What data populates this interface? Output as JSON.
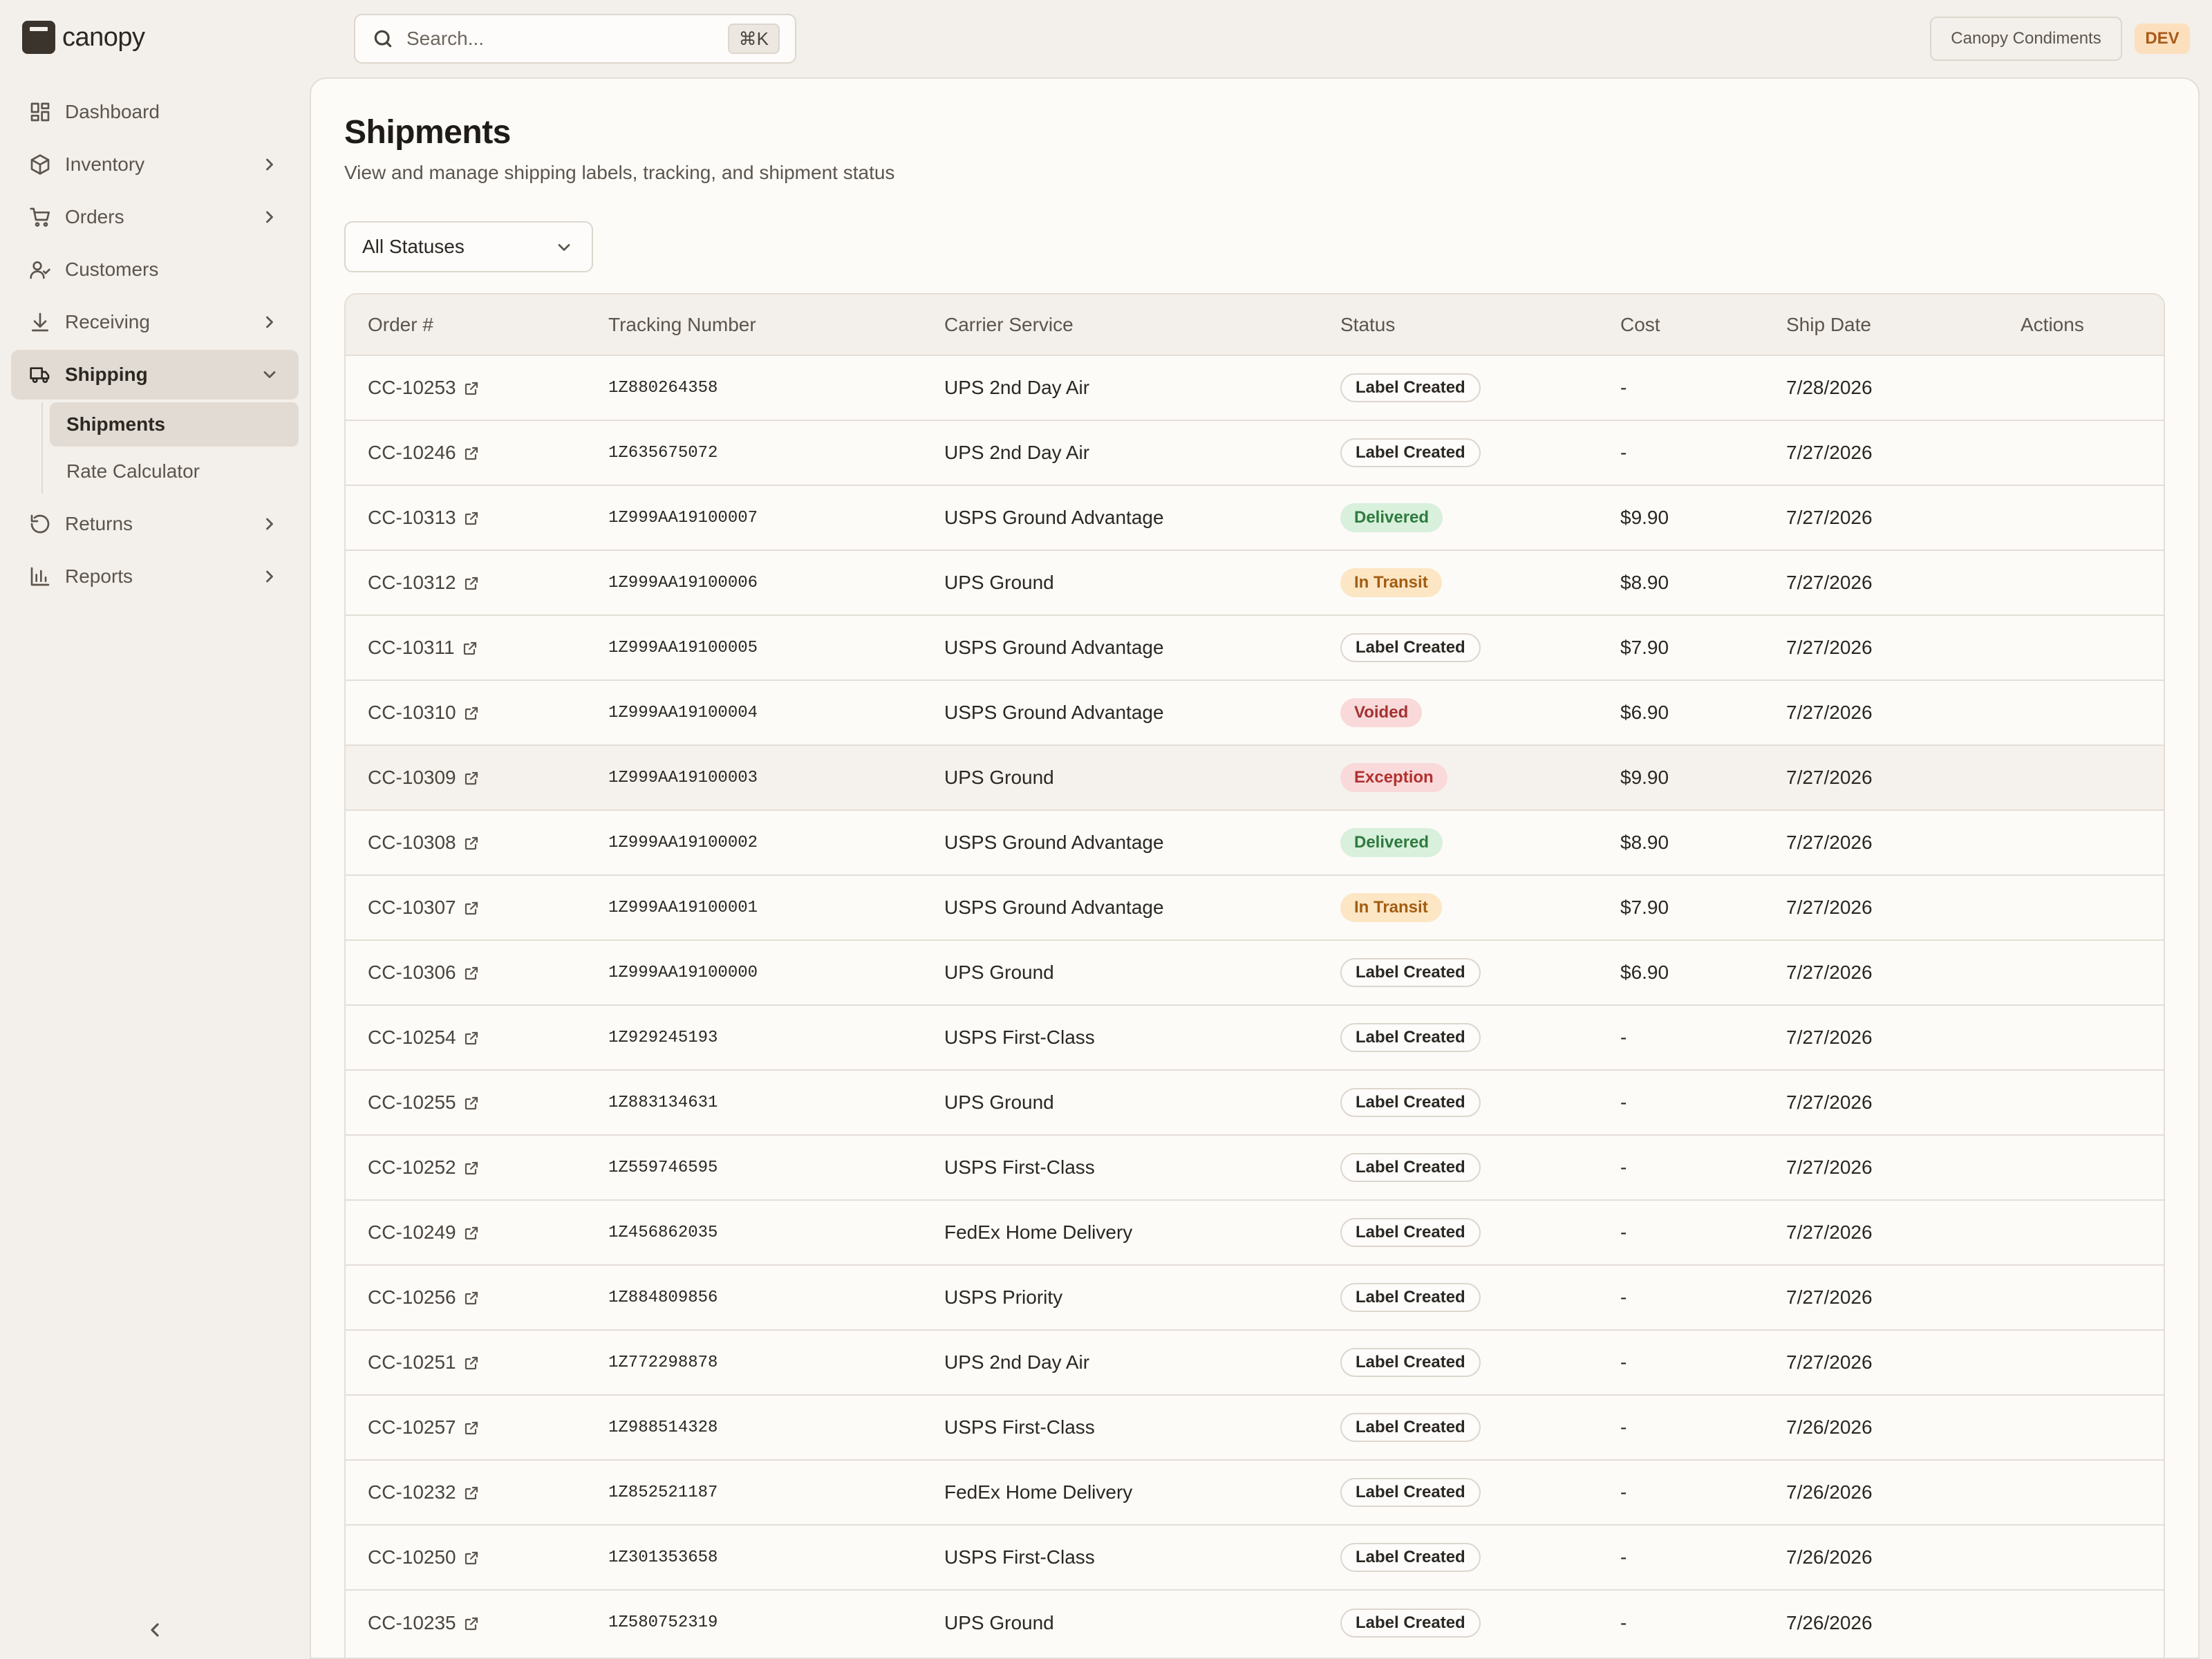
{
  "app": {
    "name": "canopy",
    "company": "Canopy Condiments",
    "env": "DEV"
  },
  "search": {
    "placeholder": "Search...",
    "shortcut": "⌘K"
  },
  "nav": {
    "dashboard": "Dashboard",
    "inventory": "Inventory",
    "orders": "Orders",
    "customers": "Customers",
    "receiving": "Receiving",
    "shipping": "Shipping",
    "shipments": "Shipments",
    "rate_calculator": "Rate Calculator",
    "returns": "Returns",
    "reports": "Reports"
  },
  "page": {
    "title": "Shipments",
    "subtitle": "View and manage shipping labels, tracking, and shipment status",
    "filter": "All Statuses"
  },
  "table": {
    "columns": [
      "Order #",
      "Tracking Number",
      "Carrier Service",
      "Status",
      "Cost",
      "Ship Date",
      "Actions"
    ],
    "rows": [
      {
        "order": "CC-10253",
        "tracking": "1Z880264358",
        "carrier": "UPS 2nd Day Air",
        "status": "Label Created",
        "cost": "-",
        "date": "7/28/2026"
      },
      {
        "order": "CC-10246",
        "tracking": "1Z635675072",
        "carrier": "UPS 2nd Day Air",
        "status": "Label Created",
        "cost": "-",
        "date": "7/27/2026"
      },
      {
        "order": "CC-10313",
        "tracking": "1Z999AA19100007",
        "carrier": "USPS Ground Advantage",
        "status": "Delivered",
        "cost": "$9.90",
        "date": "7/27/2026"
      },
      {
        "order": "CC-10312",
        "tracking": "1Z999AA19100006",
        "carrier": "UPS Ground",
        "status": "In Transit",
        "cost": "$8.90",
        "date": "7/27/2026"
      },
      {
        "order": "CC-10311",
        "tracking": "1Z999AA19100005",
        "carrier": "USPS Ground Advantage",
        "status": "Label Created",
        "cost": "$7.90",
        "date": "7/27/2026"
      },
      {
        "order": "CC-10310",
        "tracking": "1Z999AA19100004",
        "carrier": "USPS Ground Advantage",
        "status": "Voided",
        "cost": "$6.90",
        "date": "7/27/2026"
      },
      {
        "order": "CC-10309",
        "tracking": "1Z999AA19100003",
        "carrier": "UPS Ground",
        "status": "Exception",
        "cost": "$9.90",
        "date": "7/27/2026"
      },
      {
        "order": "CC-10308",
        "tracking": "1Z999AA19100002",
        "carrier": "USPS Ground Advantage",
        "status": "Delivered",
        "cost": "$8.90",
        "date": "7/27/2026"
      },
      {
        "order": "CC-10307",
        "tracking": "1Z999AA19100001",
        "carrier": "USPS Ground Advantage",
        "status": "In Transit",
        "cost": "$7.90",
        "date": "7/27/2026"
      },
      {
        "order": "CC-10306",
        "tracking": "1Z999AA19100000",
        "carrier": "UPS Ground",
        "status": "Label Created",
        "cost": "$6.90",
        "date": "7/27/2026"
      },
      {
        "order": "CC-10254",
        "tracking": "1Z929245193",
        "carrier": "USPS First-Class",
        "status": "Label Created",
        "cost": "-",
        "date": "7/27/2026"
      },
      {
        "order": "CC-10255",
        "tracking": "1Z883134631",
        "carrier": "UPS Ground",
        "status": "Label Created",
        "cost": "-",
        "date": "7/27/2026"
      },
      {
        "order": "CC-10252",
        "tracking": "1Z559746595",
        "carrier": "USPS First-Class",
        "status": "Label Created",
        "cost": "-",
        "date": "7/27/2026"
      },
      {
        "order": "CC-10249",
        "tracking": "1Z456862035",
        "carrier": "FedEx Home Delivery",
        "status": "Label Created",
        "cost": "-",
        "date": "7/27/2026"
      },
      {
        "order": "CC-10256",
        "tracking": "1Z884809856",
        "carrier": "USPS Priority",
        "status": "Label Created",
        "cost": "-",
        "date": "7/27/2026"
      },
      {
        "order": "CC-10251",
        "tracking": "1Z772298878",
        "carrier": "UPS 2nd Day Air",
        "status": "Label Created",
        "cost": "-",
        "date": "7/27/2026"
      },
      {
        "order": "CC-10257",
        "tracking": "1Z988514328",
        "carrier": "USPS First-Class",
        "status": "Label Created",
        "cost": "-",
        "date": "7/26/2026"
      },
      {
        "order": "CC-10232",
        "tracking": "1Z852521187",
        "carrier": "FedEx Home Delivery",
        "status": "Label Created",
        "cost": "-",
        "date": "7/26/2026"
      },
      {
        "order": "CC-10250",
        "tracking": "1Z301353658",
        "carrier": "USPS First-Class",
        "status": "Label Created",
        "cost": "-",
        "date": "7/26/2026"
      },
      {
        "order": "CC-10235",
        "tracking": "1Z580752319",
        "carrier": "UPS Ground",
        "status": "Label Created",
        "cost": "-",
        "date": "7/26/2026"
      }
    ]
  },
  "icons": {
    "search": "search-icon",
    "external_link": "external-link-icon",
    "chevron_right": "chevron-right-icon",
    "chevron_down": "chevron-down-icon",
    "collapse": "chevron-left-icon"
  }
}
